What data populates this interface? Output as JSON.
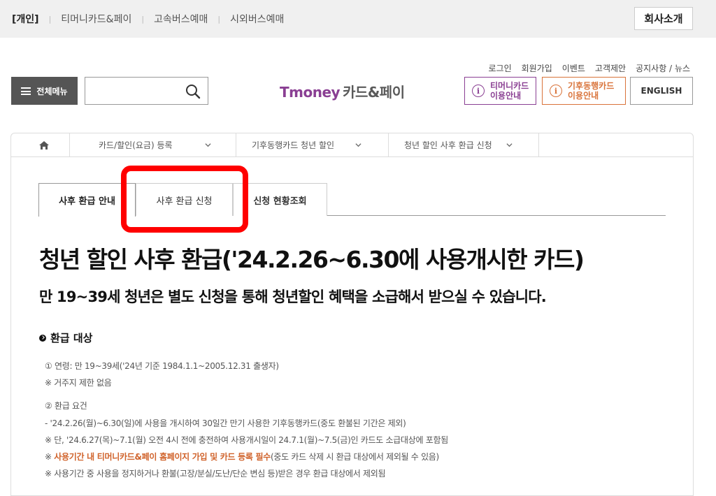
{
  "topbar": {
    "nav": [
      "[개인]",
      "티머니카드&페이",
      "고속버스예매",
      "시외버스예매"
    ],
    "company_button": "회사소개"
  },
  "utils": [
    "로그인",
    "회원가입",
    "이벤트",
    "고객제안",
    "공지사항 / 뉴스"
  ],
  "header": {
    "menu_label": "전체메뉴",
    "search_placeholder": "",
    "logo_brand": "Tmoney",
    "logo_rest": "카드&페이",
    "guide1_line1": "티머니카드",
    "guide1_line2": "이용안내",
    "guide2_line1": "기후동행카드",
    "guide2_line2": "이용안내",
    "english": "ENGLISH"
  },
  "breadcrumb": {
    "items": [
      "카드/할인(요금) 등록",
      "기후동행카드 청년 할인",
      "청년 할인 사후 환급 신청"
    ]
  },
  "tabs": [
    "사후 환급 안내",
    "사후 환급 신청",
    "신청 현황조회"
  ],
  "content": {
    "title": "청년 할인 사후 환급('24.2.26~6.30에 사용개시한 카드)",
    "subtitle": "만 19~39세 청년은 별도 신청을 통해 청년할인 혜택을 소급해서 받으실 수 있습니다.",
    "section_title": "환급 대상",
    "line1": "① 연령: 만 19~39세('24년 기준 1984.1.1~2005.12.31 출생자)",
    "line2": "※ 거주지 제한 없음",
    "line3": "② 환급 요건",
    "line4": "- '24.2.26(월)~6.30(일)에 사용을 개시하여 30일간 만기 사용한 기후동행카드(중도 환불된 기간은 제외)",
    "line5": "※ 단, '24.6.27(목)~7.1(월) 오전 4시 전에 충전하여 사용개시일이 24.7.1(월)~7.5(금)인 카드도 소급대상에 포함됨",
    "line6_prefix": "※ ",
    "line6_highlight": "사용기간 내 티머니카드&페이 홈페이지 가입 및 카드 등록 필수",
    "line6_rest": "(중도 카드 삭제 시 환급 대상에서 제외될 수 있음)",
    "line7": "※ 사용기간 중 사용을 정지하거나 환불(고장/분실/도난/단순 변심 등)받은 경우 환급 대상에서 제외됨"
  },
  "colors": {
    "brand_purple": "#8a3f93",
    "orange": "#d9733a",
    "highlight_red": "#ff0000"
  }
}
